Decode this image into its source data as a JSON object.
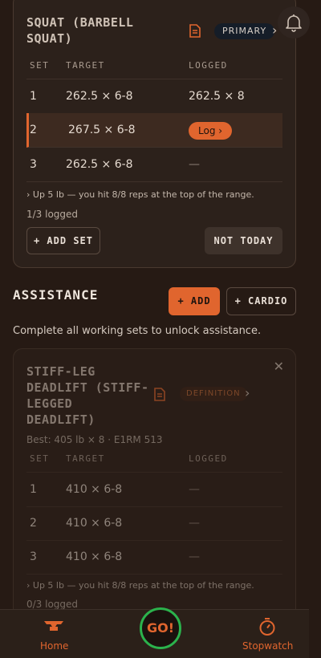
{
  "primary_exercise": {
    "title_line1": "SQUAT (BARBELL",
    "title_line2": "SQUAT)",
    "badge": "PRIMARY",
    "columns": [
      "SET",
      "TARGET",
      "LOGGED"
    ],
    "sets": [
      {
        "set": "1",
        "target": "262.5 × 6-8",
        "logged": "262.5 × 8"
      },
      {
        "set": "2",
        "target": "267.5 × 6-8",
        "logged": "Log ›"
      },
      {
        "set": "3",
        "target": "262.5 × 6-8",
        "logged": "—"
      }
    ],
    "hint": "›  Up 5 lb — you hit 8/8 reps at the top of the range.",
    "logged_count": "1/3 logged",
    "add_set_label": "+ ADD SET",
    "not_today_label": "NOT TODAY"
  },
  "assistance": {
    "title": "ASSISTANCE",
    "add_label": "+ ADD",
    "cardio_label": "+ CARDIO",
    "note": "Complete all working sets to unlock assistance."
  },
  "assistance_exercise": {
    "title_lines": [
      "STIFF-LEG",
      "DEADLIFT (STIFF-",
      "LEGGED",
      "DEADLIFT)"
    ],
    "badge": "DEFINITION",
    "best": "Best: 405 lb × 8 · E1RM 513",
    "columns": [
      "SET",
      "TARGET",
      "LOGGED"
    ],
    "sets": [
      {
        "set": "1",
        "target": "410 × 6-8",
        "logged": "—"
      },
      {
        "set": "2",
        "target": "410 × 6-8",
        "logged": "—"
      },
      {
        "set": "3",
        "target": "410 × 6-8",
        "logged": "—"
      }
    ],
    "hint": "›  Up 5 lb — you hit 8/8 reps at the top of the range.",
    "logged_count": "0/3 logged"
  },
  "bottom_nav": {
    "home_label": "Home",
    "go_label": "GO!",
    "stopwatch_label": "Stopwatch"
  },
  "colors": {
    "accent": "#e0652e",
    "background": "#261a14",
    "go_ring": "#2bb24c"
  }
}
